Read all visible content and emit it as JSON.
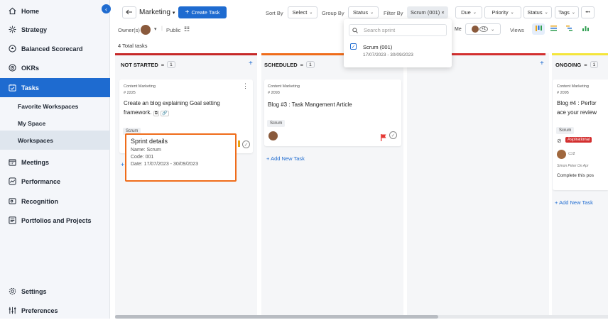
{
  "sidebar": {
    "items": [
      {
        "label": "Home",
        "icon": "home-icon"
      },
      {
        "label": "Strategy",
        "icon": "strategy-icon"
      },
      {
        "label": "Balanced Scorecard",
        "icon": "scorecard-icon"
      },
      {
        "label": "OKRs",
        "icon": "target-icon"
      },
      {
        "label": "Tasks",
        "icon": "tasks-icon"
      },
      {
        "label": "Favorite Workspaces"
      },
      {
        "label": "My Space"
      },
      {
        "label": "Workspaces"
      },
      {
        "label": "Meetings",
        "icon": "calendar-icon"
      },
      {
        "label": "Performance",
        "icon": "performance-icon"
      },
      {
        "label": "Recognition",
        "icon": "recognition-icon"
      },
      {
        "label": "Portfolios and Projects",
        "icon": "portfolio-icon"
      },
      {
        "label": "Settings",
        "icon": "gear-icon"
      },
      {
        "label": "Preferences",
        "icon": "sliders-icon"
      }
    ]
  },
  "toolbar": {
    "workspace": "Marketing",
    "create_task": "Create Task",
    "sort_by": "Sort By",
    "sort_value": "Select",
    "group_by": "Group By",
    "group_value": "Status",
    "filter_by": "Filter By",
    "filter_chip": "Scrum (001) ×",
    "due": "Due",
    "priority": "Priority",
    "status": "Status",
    "tags": "Tags",
    "more": "•••",
    "owners": "Owner(s)",
    "public": "Public",
    "me": "Me",
    "extra_count": "+1",
    "views": "Views"
  },
  "total_tasks": "4  Total tasks",
  "columns": [
    {
      "name": "NOT STARTED",
      "count": "1",
      "color": "#c62828"
    },
    {
      "name": "SCHEDULED",
      "count": "1",
      "color": "#ef6c1a"
    },
    {
      "name": "",
      "count": "",
      "color": "#d32f2f"
    },
    {
      "name": "ONGOING",
      "count": "1",
      "color": "#f4e53a"
    }
  ],
  "cards": {
    "c1": {
      "category": "Content Marketing",
      "id": "# 2225",
      "title": "Create an blog explaining Goal setting framework.",
      "tag": "Scrum"
    },
    "c2": {
      "category": "Content Marketing",
      "id": "# 2093",
      "title": "Blog #3 : Task Mangement Article",
      "tag": "Scrum"
    },
    "c3": {
      "category": "Content Marketing",
      "id": "# 2095",
      "title_line1": "Blog #4 : Perfor",
      "title_line2": "ace your review",
      "tag": "Scrum",
      "badge": "Aspirational",
      "comments": "2",
      "comment_meta": "Simon Peter On Apr",
      "comment_text": "Complete this pos"
    }
  },
  "add_task": "Add New Task",
  "dropdown": {
    "search_placeholder": "Search sprint",
    "option_name": "Scrum (001)",
    "option_dates": "17/07/2023 - 30/09/2023"
  },
  "tooltip": {
    "title": "Sprint details",
    "name": "Name:  Scrum",
    "code": "Code:  001",
    "date": "Date:  17/07/2023 - 30/09/2023"
  },
  "colors": {
    "accent": "#1e6bd0",
    "highlight": "#ef6c1a"
  }
}
